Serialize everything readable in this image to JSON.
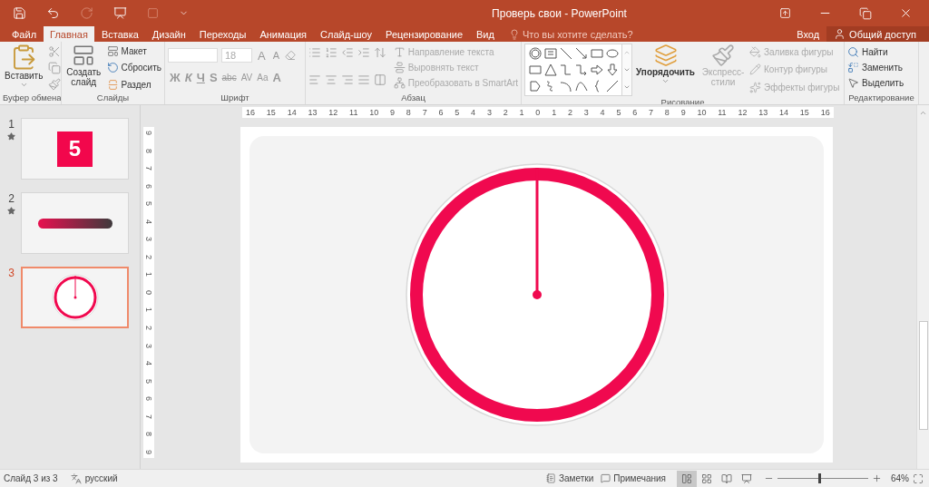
{
  "title_bar": {
    "title": "Проверь свои - PowerPoint"
  },
  "tabs": [
    {
      "label": "Файл",
      "selected": false
    },
    {
      "label": "Главная",
      "selected": true
    },
    {
      "label": "Вставка",
      "selected": false
    },
    {
      "label": "Дизайн",
      "selected": false
    },
    {
      "label": "Переходы",
      "selected": false
    },
    {
      "label": "Анимация",
      "selected": false
    },
    {
      "label": "Слайд-шоу",
      "selected": false
    },
    {
      "label": "Рецензирование",
      "selected": false
    },
    {
      "label": "Вид",
      "selected": false
    }
  ],
  "tell_me": {
    "placeholder": "Что вы хотите сделать?"
  },
  "sign_in": "Вход",
  "share": "Общий доступ",
  "ribbon": {
    "clipboard": {
      "label": "Буфер обмена",
      "paste": "Вставить"
    },
    "slides": {
      "label": "Слайды",
      "new_slide": "Создать слайд",
      "layout": "Макет",
      "reset": "Сбросить",
      "section": "Раздел"
    },
    "font": {
      "label": "Шрифт",
      "disabled": true,
      "size": "18",
      "size_buttons": [
        "A",
        "A"
      ],
      "style_buttons": [
        "Ж",
        "К",
        "Ч",
        "S",
        "abc",
        "AV",
        "Aa"
      ],
      "color_button": "A"
    },
    "paragraph": {
      "label": "Абзац",
      "disabled": true,
      "items": [
        "Направление текста",
        "Выровнять текст",
        "Преобразовать в SmartArt"
      ]
    },
    "drawing": {
      "label": "Рисование",
      "arrange": {
        "text": "Упорядочить",
        "disabled": false
      },
      "quick_styles": {
        "text": "Экспресс-стили",
        "disabled": true
      },
      "items": [
        {
          "text": "Заливка фигуры",
          "disabled": true
        },
        {
          "text": "Контур фигуры",
          "disabled": true
        },
        {
          "text": "Эффекты фигуры",
          "disabled": true
        }
      ]
    },
    "editing": {
      "label": "Редактирование",
      "items": [
        "Найти",
        "Заменить",
        "Выделить"
      ]
    }
  },
  "slides": [
    {
      "number": "1",
      "animated": true,
      "selected": false,
      "kind": "number",
      "text": "5"
    },
    {
      "number": "2",
      "animated": true,
      "selected": false,
      "kind": "bar"
    },
    {
      "number": "3",
      "animated": false,
      "selected": true,
      "kind": "clock"
    }
  ],
  "ruler_h": [
    "16",
    "15",
    "14",
    "13",
    "12",
    "11",
    "10",
    "9",
    "8",
    "7",
    "6",
    "5",
    "4",
    "3",
    "2",
    "1",
    "0",
    "1",
    "2",
    "3",
    "4",
    "5",
    "6",
    "7",
    "8",
    "9",
    "10",
    "11",
    "12",
    "13",
    "14",
    "15",
    "16"
  ],
  "ruler_v": [
    "9",
    "8",
    "7",
    "6",
    "5",
    "4",
    "3",
    "2",
    "1",
    "0",
    "1",
    "2",
    "3",
    "4",
    "5",
    "6",
    "7",
    "8",
    "9"
  ],
  "status_bar": {
    "slide_info": "Слайд 3 из 3",
    "language": "русский",
    "notes": "Заметки",
    "comments": "Примечания",
    "zoom": {
      "level": 0.46,
      "text": "64%"
    }
  }
}
